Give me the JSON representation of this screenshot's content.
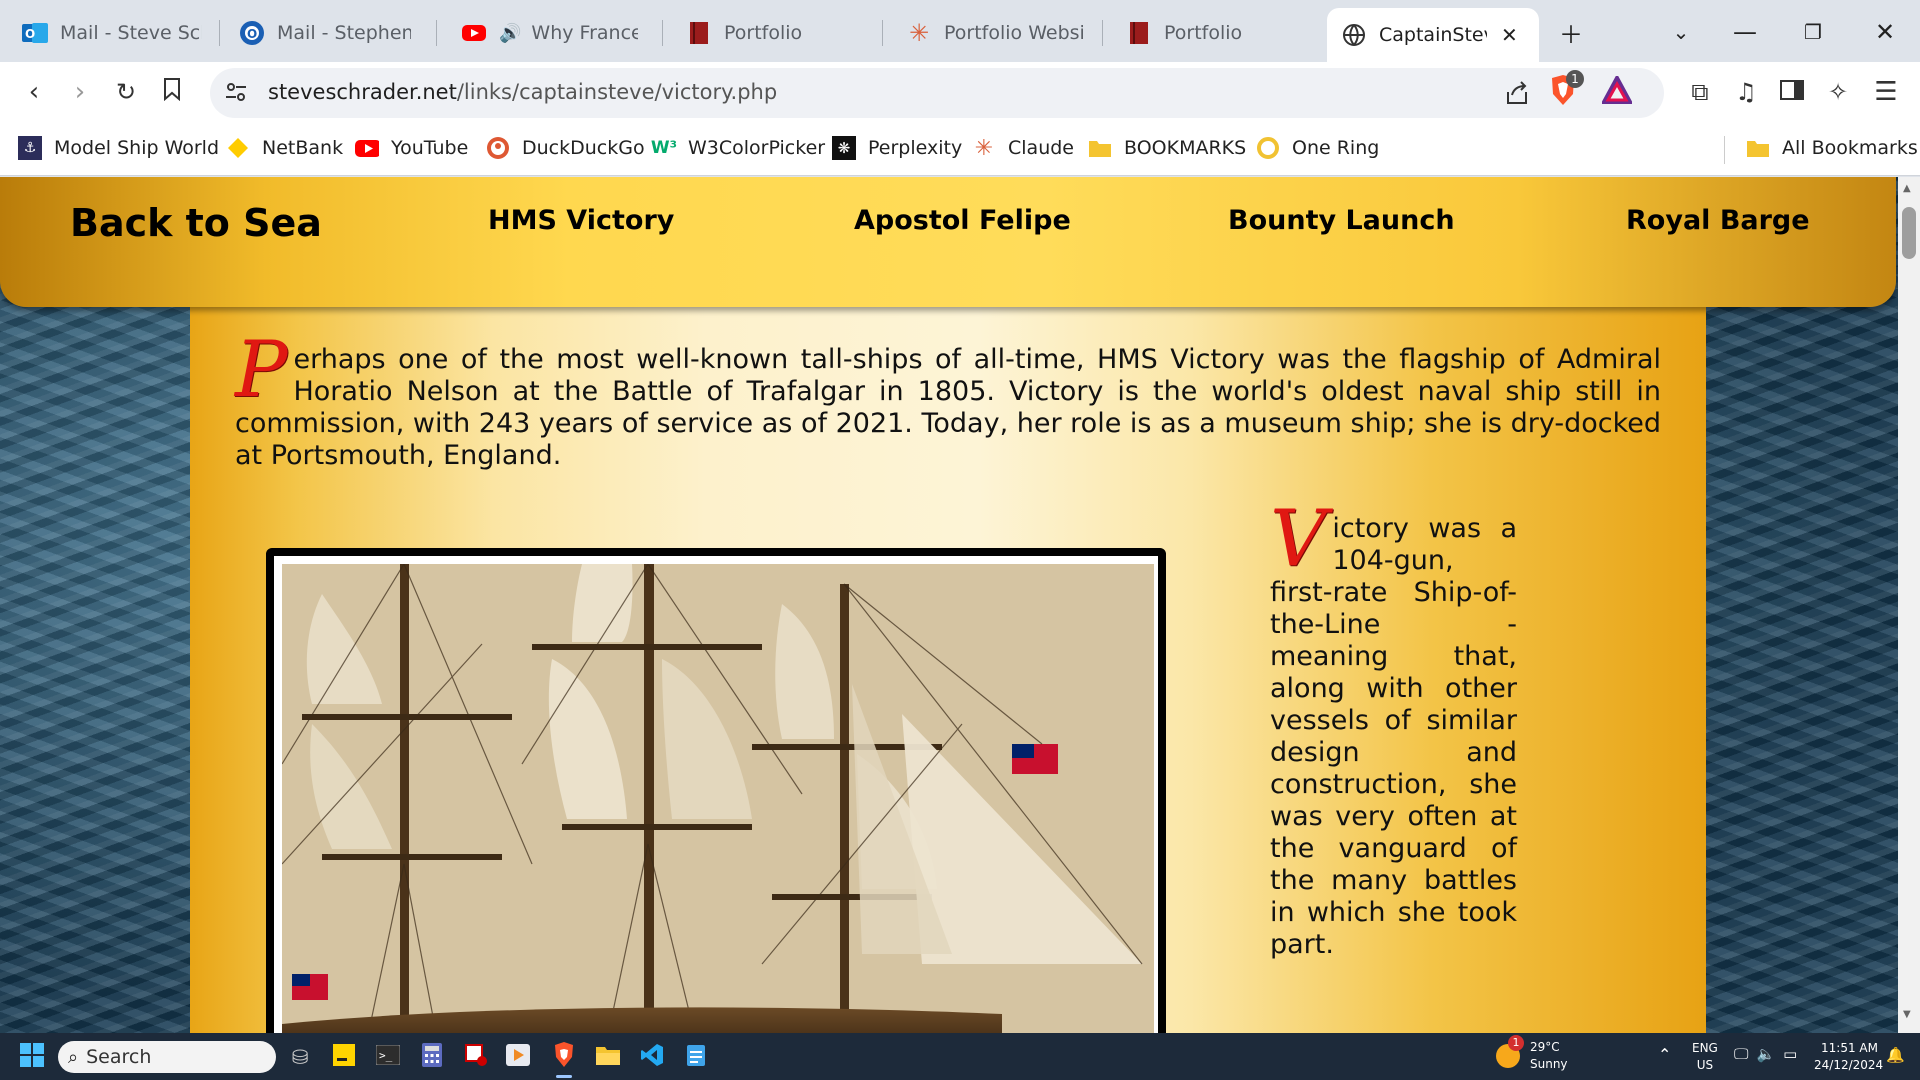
{
  "browser": {
    "tabs": [
      {
        "label": "Mail - Steve Schra",
        "icon": "outlook-icon"
      },
      {
        "label": "Mail - Stephen Sc",
        "icon": "outlook-icon"
      },
      {
        "label": "Why France a",
        "icon": "youtube-icon"
      },
      {
        "label": "Portfolio",
        "icon": "portfolio-icon"
      },
      {
        "label": "Portfolio Website",
        "icon": "claude-icon"
      },
      {
        "label": "Portfolio",
        "icon": "portfolio-icon"
      },
      {
        "label": "CaptainSteve",
        "icon": "globe-icon"
      }
    ],
    "url_host": "steveschrader.net",
    "url_path": "/links/captainsteve/victory.php",
    "brave_badge": "1",
    "bookmarks": [
      {
        "label": "Model Ship World",
        "icon": "ship-icon"
      },
      {
        "label": "NetBank",
        "icon": "netbank-icon"
      },
      {
        "label": "YouTube",
        "icon": "youtube-icon"
      },
      {
        "label": "DuckDuckGo",
        "icon": "duckduckgo-icon"
      },
      {
        "label": "W3ColorPicker",
        "icon": "w3-icon"
      },
      {
        "label": "Perplexity",
        "icon": "perplexity-icon"
      },
      {
        "label": "Claude",
        "icon": "claude-icon"
      },
      {
        "label": "BOOKMARKS",
        "icon": "folder-icon"
      },
      {
        "label": "One Ring",
        "icon": "ring-icon"
      }
    ],
    "all_bookmarks": "All Bookmarks"
  },
  "site": {
    "nav": {
      "home": "Back to Sea",
      "links": [
        "HMS Victory",
        "Apostol Felipe",
        "Bounty Launch",
        "Royal Barge"
      ]
    },
    "intro": {
      "dropcap": "P",
      "text": "erhaps one of the most well-known tall-ships of all-time, HMS Victory was the flagship of Admiral Horatio Nelson at the Battle of Trafalgar in 1805. Victory is the world's oldest naval ship still in commission, with 243 years of service as of 2021. Today, her role is as a museum ship; she is dry-docked at Portsmouth, England."
    },
    "side": {
      "dropcap": "V",
      "text": "ictory was a 104-gun, first-rate Ship-of-the-Line - meaning that, along with other vessels of similar design and construction, she was very often at the vanguard of the many battles in which she took part."
    }
  },
  "taskbar": {
    "search_placeholder": "Search",
    "weather_temp": "29°C",
    "weather_desc": "Sunny",
    "weather_badge": "1",
    "lang_top": "ENG",
    "lang_bottom": "US",
    "time": "11:51 AM",
    "date": "24/12/2024"
  },
  "colors": {
    "accent_dropcap": "#e01812",
    "nav_gold": "#ffd84f"
  }
}
